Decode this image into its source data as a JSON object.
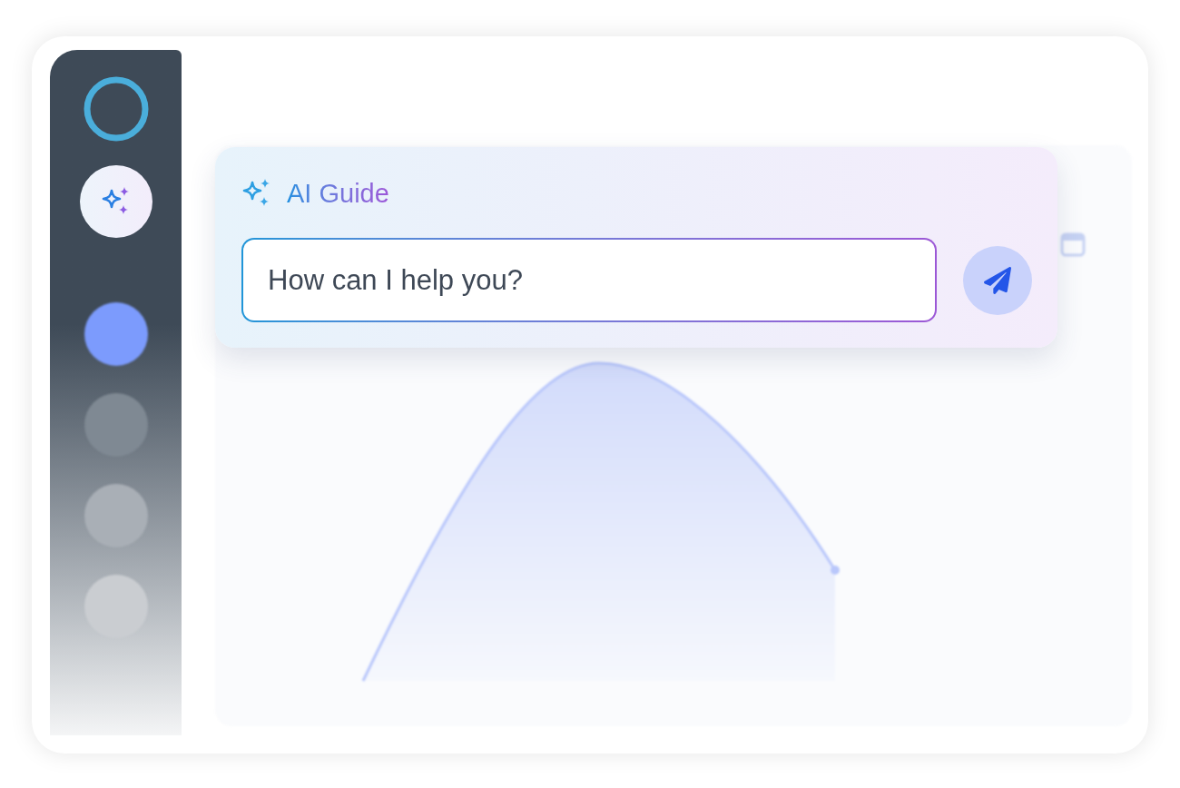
{
  "sidebar": {
    "items": [
      {
        "kind": "assistant",
        "selected": true
      },
      {
        "kind": "dot",
        "selected": false,
        "color": "#7c9bfd"
      },
      {
        "kind": "dot",
        "selected": false,
        "color": "#7f8993"
      },
      {
        "kind": "dot",
        "selected": false,
        "color": "#a9afb6"
      },
      {
        "kind": "dot",
        "selected": false,
        "color": "#cacdd1"
      }
    ]
  },
  "ai_guide": {
    "title": "AI Guide",
    "input": {
      "placeholder": "How can I help you?"
    }
  }
}
